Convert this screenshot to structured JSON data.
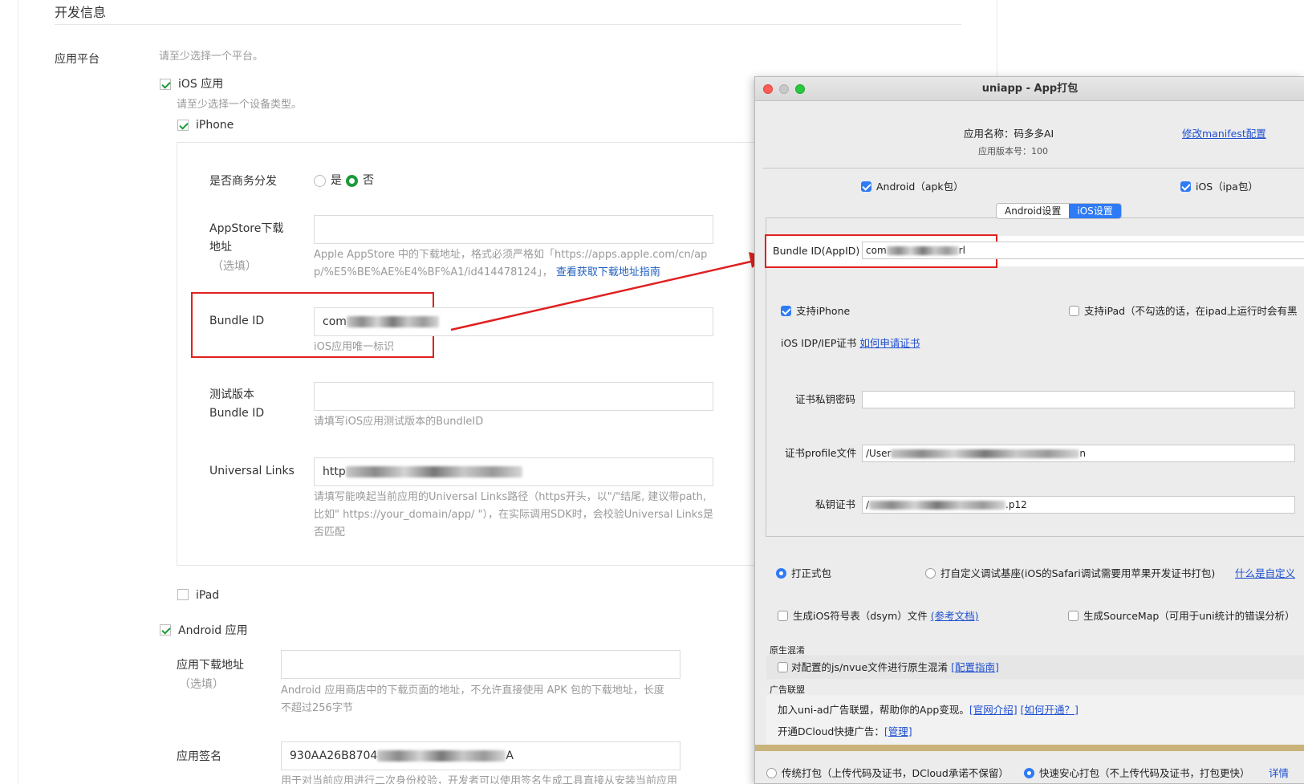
{
  "section": {
    "title": "开发信息"
  },
  "platform": {
    "label": "应用平台",
    "hint": "请至少选择一个平台。"
  },
  "ios": {
    "label": "iOS 应用",
    "checked": true,
    "device_hint": "请至少选择一个设备类型。",
    "iphone_label": "iPhone",
    "ipad_label": "iPad",
    "business": {
      "label": "是否商务分发",
      "yes": "是",
      "no": "否",
      "selected": "否"
    },
    "appstore": {
      "label_line1": "AppStore下载",
      "label_line2": "地址",
      "label_optional": "（选填）",
      "hint_line1": "Apple AppStore 中的下载地址，格式必须严格如「https://apps.apple.com/cn/ap",
      "hint_line2": "p/%E5%BE%AE%E4%BF%A1/id414478124」，",
      "hint_link": "查看获取下载地址指南"
    },
    "bundle": {
      "label": "Bundle ID",
      "value_prefix": "com",
      "hint": "iOS应用唯一标识"
    },
    "test_bundle": {
      "label_line1": "测试版本",
      "label_line2": "Bundle ID",
      "hint": "请填写iOS应用测试版本的BundleID"
    },
    "universal": {
      "label": "Universal Links",
      "value_prefix": "http",
      "hint_line1": "请填写能唤起当前应用的Universal Links路径（https开头，以\"/\"结尾, 建议带path,",
      "hint_line2": "比如\" https://your_domain/app/ \"），在实际调用SDK时，会校验Universal Links是",
      "hint_line3": "否匹配"
    }
  },
  "android": {
    "label": "Android 应用",
    "checked": true,
    "download": {
      "label": "应用下载地址",
      "label_optional": "（选填）",
      "hint_line1": "Android 应用商店中的下载页面的地址，不允许直接使用 APK 包的下载地址，长度",
      "hint_line2": "不超过256字节"
    },
    "signature": {
      "label": "应用签名",
      "value_prefix": "930AA26B8704",
      "value_suffix": "A",
      "hint": "用于对当前应用进行二次身份校验，开发者可以使用签名生成工具直接从安装当前应用"
    }
  },
  "window": {
    "title": "uniapp - App打包",
    "app_name_label": "应用名称：码多多AI",
    "app_version_label": "应用版本号：100",
    "edit_manifest_link": "修改manifest配置",
    "android_check": "Android（apk包）",
    "ios_check": "iOS（ipa包）",
    "tabs": [
      "Android设置",
      "iOS设置"
    ],
    "active_tab": "iOS设置",
    "bundle_label": "Bundle ID(AppID)",
    "bundle_value_prefix": "com",
    "bundle_value_suffix": "rl",
    "support_iphone": "支持iPhone",
    "support_ipad": "支持iPad（不勾选的话，在ipad上运行时会有黑",
    "cert_label": "iOS IDP/IEP证书",
    "cert_link": "如何申请证书",
    "cert_password_label": "证书私钥密码",
    "profile_label": "证书profile文件",
    "profile_value_prefix": "/User",
    "profile_value_suffix": "n",
    "private_cert_label": "私钥证书",
    "private_cert_value_prefix": "/",
    "private_cert_value_suffix": ".p12",
    "release_radio": "打正式包",
    "custom_base_radio": "打自定义调试基座(iOS的Safari调试需要用苹果开发证书打包)",
    "custom_base_link": "什么是自定义",
    "dsym_check": "生成iOS符号表（dsym）文件",
    "dsym_link": "(参考文档)",
    "sourcemap_check": "生成SourceMap（可用于uni统计的错误分析）",
    "obfuscation_header": "原生混淆",
    "obfuscation_check": "对配置的js/nvue文件进行原生混淆",
    "obfuscation_link": "[配置指南]",
    "ad_header": "广告联盟",
    "ad_text": "加入uni-ad广告联盟，帮助你的App变现。",
    "ad_link1": "[官网介绍]",
    "ad_link2": "[如何开通？]",
    "dcloud_ad_text": "开通DCloud快捷广告：",
    "dcloud_ad_link": "[管理]",
    "traditional_radio": "传统打包（上传代码及证书，DCloud承诺不保留）",
    "safe_radio": "快速安心打包（不上传代码及证书，打包更快）",
    "details_link": "详情",
    "selected_pack": "safe"
  }
}
